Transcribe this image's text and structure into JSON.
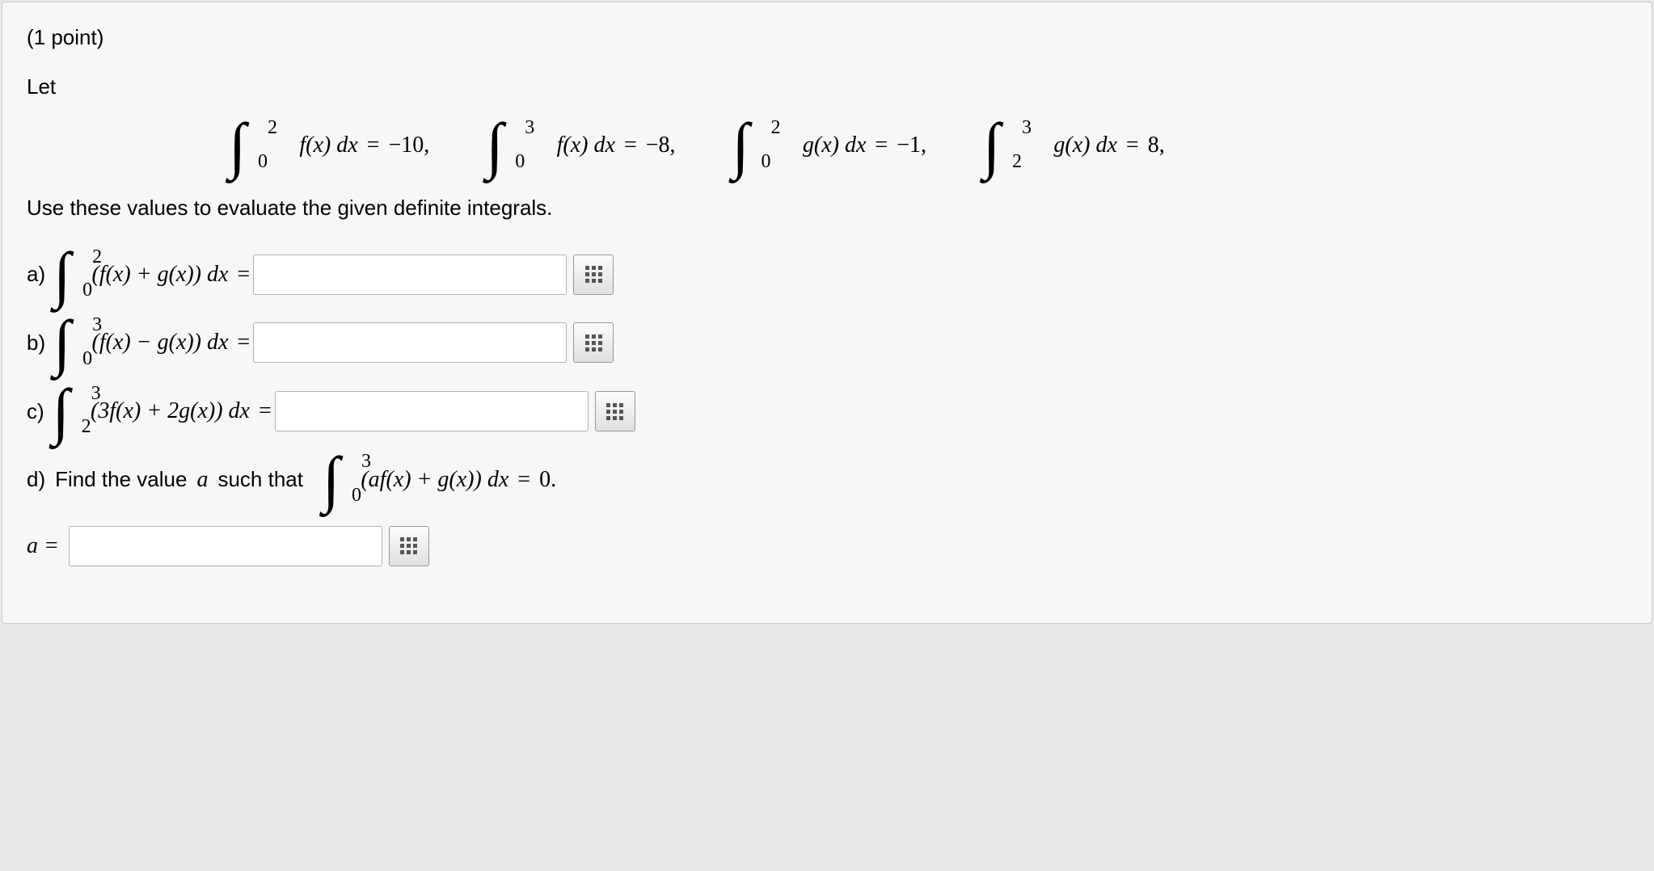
{
  "header": {
    "points": "(1 point)"
  },
  "intro": "Let",
  "given": [
    {
      "lo": "0",
      "up": "2",
      "fn": "f(x)",
      "val": "−10"
    },
    {
      "lo": "0",
      "up": "3",
      "fn": "f(x)",
      "val": "−8"
    },
    {
      "lo": "0",
      "up": "2",
      "fn": "g(x)",
      "val": "−1"
    },
    {
      "lo": "2",
      "up": "3",
      "fn": "g(x)",
      "val": "8"
    }
  ],
  "instruction": "Use these values to evaluate the given definite integrals.",
  "parts": {
    "a": {
      "label": "a)",
      "lo": "0",
      "up": "2",
      "integrand": "(f(x) + g(x))",
      "value": ""
    },
    "b": {
      "label": "b)",
      "lo": "0",
      "up": "3",
      "integrand": "(f(x) − g(x))",
      "value": ""
    },
    "c": {
      "label": "c)",
      "lo": "2",
      "up": "3",
      "integrand": "(3f(x) + 2g(x))",
      "value": ""
    },
    "d": {
      "label": "d)",
      "text_before": "Find the value",
      "var": "a",
      "text_after": "such that",
      "lo": "0",
      "up": "3",
      "integrand": "(af(x) + g(x))",
      "rhs": "0",
      "answer_label": "a =",
      "value": ""
    }
  },
  "dx": "dx",
  "equals": "="
}
